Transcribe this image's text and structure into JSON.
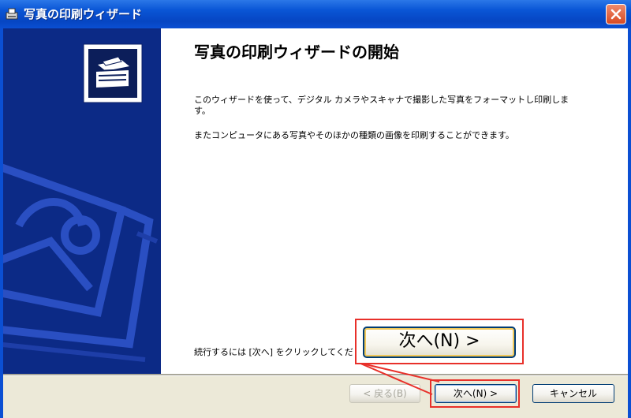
{
  "window": {
    "title": "写真の印刷ウィザード",
    "close_icon": "close-icon",
    "app_icon": "printer-wizard-icon"
  },
  "leftpanel": {
    "icon": "photo-printer-icon",
    "background": "#0c2a86"
  },
  "content": {
    "heading": "写真の印刷ウィザードの開始",
    "paragraph1": "このウィザードを使って、デジタル カメラやスキャナで撮影した写真をフォーマットし印刷します。",
    "paragraph2": "またコンピュータにある写真やそのほかの種類の画像を印刷することができます。",
    "continue_text": "続行するには [次へ] をクリックしてくだ"
  },
  "buttons": {
    "back": "< 戻る(B)",
    "next": "次へ(N) >",
    "cancel": "キャンセル"
  },
  "callout": {
    "zoomed_label": "次へ(N) >",
    "highlight_color": "#e8302a"
  }
}
